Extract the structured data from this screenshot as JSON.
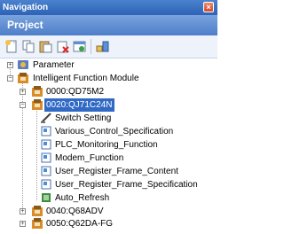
{
  "window": {
    "title": "Navigation",
    "close_symbol": "×"
  },
  "panel": {
    "header": "Project"
  },
  "toolbar": {
    "buttons": [
      {
        "icon": "new-data-icon"
      },
      {
        "icon": "copy-icon"
      },
      {
        "icon": "paste-icon"
      },
      {
        "icon": "delete-icon"
      },
      {
        "icon": "properties-icon"
      },
      {
        "icon": "find-icon"
      }
    ]
  },
  "tree": {
    "parameter": "Parameter",
    "intelligent_function_module": "Intelligent Function Module",
    "modules": [
      {
        "label": "0000:QD75M2",
        "expander": "+"
      },
      {
        "label": "0020:QJ71C24N",
        "expander": "−"
      },
      {
        "label": "0040:Q68ADV",
        "expander": "+"
      },
      {
        "label": "0050:Q62DA-FG",
        "expander": "+"
      }
    ],
    "children": [
      "Switch Setting",
      "Various_Control_Specification",
      "PLC_Monitoring_Function",
      "Modem_Function",
      "User_Register_Frame_Content",
      "User_Register_Frame_Specification",
      "Auto_Refresh"
    ],
    "expanders": {
      "collapsed": "+",
      "expanded": "−"
    }
  },
  "colors": {
    "accent": "#316ac5",
    "title_bar": "#2d62b5"
  }
}
